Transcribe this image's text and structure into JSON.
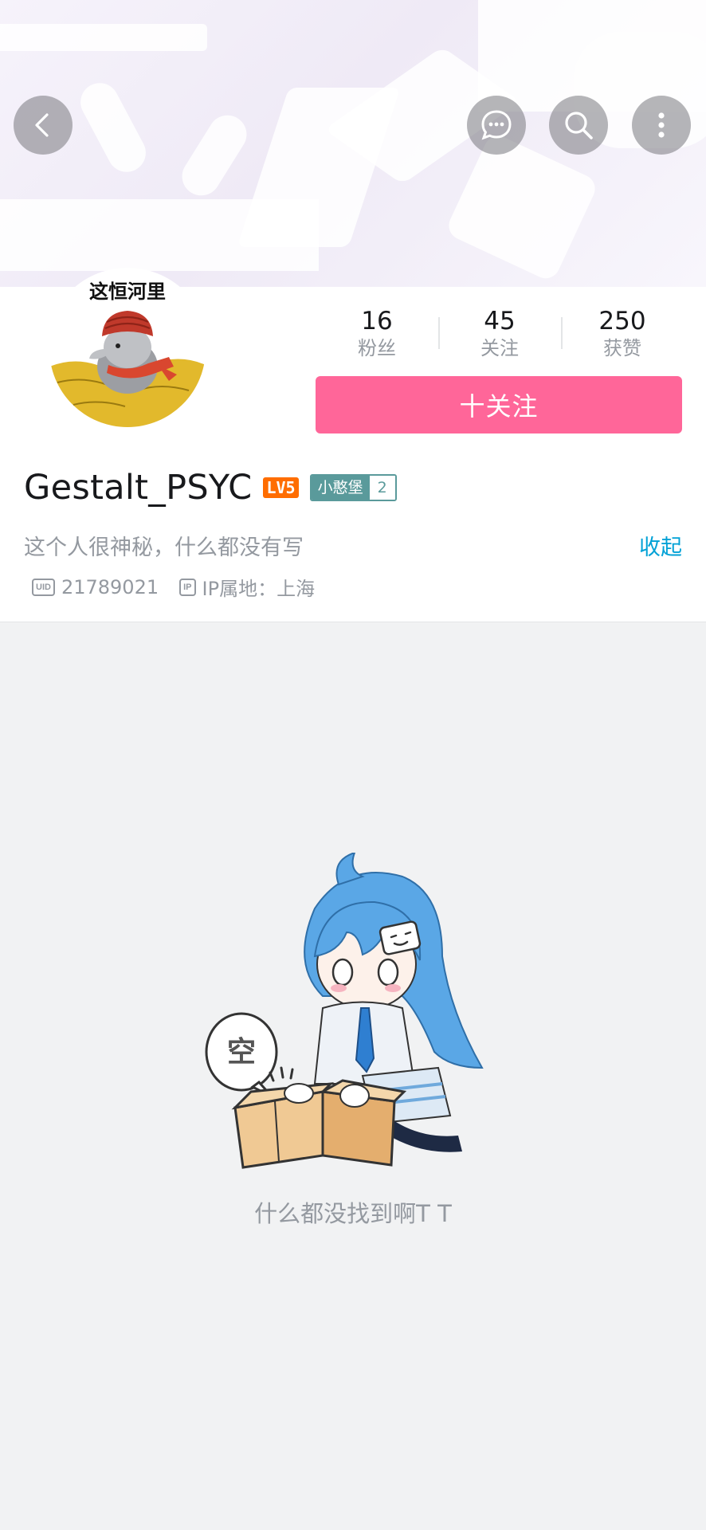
{
  "header": {
    "back_icon": "chevron-left-icon",
    "message_icon": "message-bubble-icon",
    "search_icon": "search-icon",
    "more_icon": "more-vertical-icon"
  },
  "profile": {
    "avatar_caption": "这恒河里",
    "stats": [
      {
        "value": "16",
        "label": "粉丝"
      },
      {
        "value": "45",
        "label": "关注"
      },
      {
        "value": "250",
        "label": "获赞"
      }
    ],
    "follow_label": "十关注",
    "username": "Gestalt_PSYC",
    "level_badge": "LV5",
    "fan_badge_name": "小憨堡",
    "fan_badge_level": "2",
    "bio": "这个人很神秘，什么都没有写",
    "collapse_label": "收起",
    "uid_icon_text": "UID",
    "uid": "21789021",
    "ip_icon_text": "IP",
    "ip_location": "IP属地：上海"
  },
  "empty_state": {
    "bubble_text": "空",
    "message": "什么都没找到啊T T"
  },
  "colors": {
    "accent_pink": "#ff6699",
    "link_blue": "#00a1d6",
    "level_orange": "#ff6d00",
    "fan_badge_teal": "#5a9a9b",
    "background": "#f1f2f3"
  }
}
